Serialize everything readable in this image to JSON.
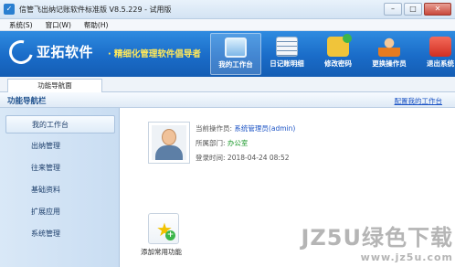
{
  "window": {
    "title": "信管飞出纳记账软件标准版 V8.5.229 - 试用版",
    "buttons": {
      "minimize": "–",
      "maximize": "□",
      "close": "✕"
    }
  },
  "menubar": {
    "items": [
      "系统(S)",
      "窗口(W)",
      "帮助(H)"
    ]
  },
  "banner": {
    "brand": "亚拓软件",
    "slogan": "· 精细化管理软件倡导者",
    "nav": [
      {
        "label": "我的工作台",
        "icon": "monitor-icon"
      },
      {
        "label": "日记账明细",
        "icon": "ledger-icon"
      },
      {
        "label": "修改密码",
        "icon": "lock-icon"
      },
      {
        "label": "更换操作员",
        "icon": "user-switch-icon"
      },
      {
        "label": "退出系统",
        "icon": "power-icon"
      }
    ]
  },
  "tabs": {
    "active": "功能导航面"
  },
  "section": {
    "title": "功能导航栏",
    "config_link": "配置我的工作台"
  },
  "sidebar": {
    "items": [
      "我的工作台",
      "出纳管理",
      "往来管理",
      "基础资料",
      "扩展应用",
      "系统管理"
    ]
  },
  "operator": {
    "operator_label": "当前操作员:",
    "operator_value": "系统管理员(admin)",
    "dept_label": "所属部门:",
    "dept_value": "办公室",
    "login_label": "登录时间:",
    "login_value": "2018-04-24 08:52"
  },
  "shortcut": {
    "label": "添加常用功能"
  },
  "watermark": {
    "line1": "JZ5U绿色下载",
    "line2": "www.jz5u.com"
  }
}
